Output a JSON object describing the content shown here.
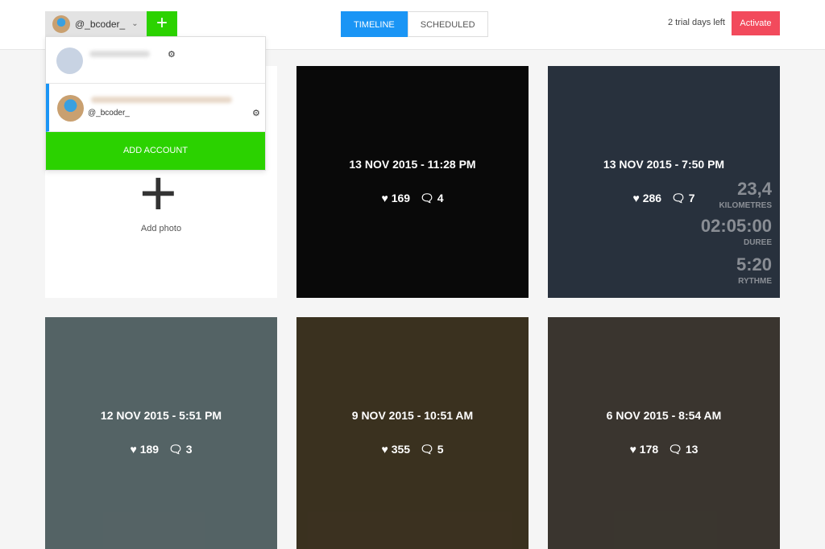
{
  "header": {
    "account": "@_bcoder_",
    "add_icon": "plus-icon",
    "tabs": [
      {
        "label": "TIMELINE",
        "active": true
      },
      {
        "label": "SCHEDULED",
        "active": false
      }
    ],
    "trial": "2 trial days left",
    "activate": "Activate"
  },
  "dropdown": {
    "accounts": [
      {
        "handle": "",
        "selected": false
      },
      {
        "handle": "@_bcoder_",
        "selected": true
      }
    ],
    "add_account": "ADD ACCOUNT"
  },
  "add_photo": {
    "label": "Add photo"
  },
  "posts": [
    {
      "date": "13 NOV 2015 - 11:28 PM",
      "likes": "169",
      "comments": "4",
      "bg": "#111"
    },
    {
      "date": "13 NOV 2015 - 7:50 PM",
      "likes": "286",
      "comments": "7",
      "bg": "#4a5a70",
      "overlay": [
        "23,4",
        "KILOMETRES",
        "02:05:00",
        "DUREE",
        "5:20",
        "RYTHME"
      ]
    },
    {
      "date": "12 NOV 2015 - 5:51 PM",
      "likes": "189",
      "comments": "3",
      "bg": "#9ab4b8"
    },
    {
      "date": "9 NOV 2015 - 10:51 AM",
      "likes": "355",
      "comments": "5",
      "bg": "#6b5a3a"
    },
    {
      "date": "6 NOV 2015 - 8:54 AM",
      "likes": "178",
      "comments": "13",
      "bg": "#6a6256"
    }
  ],
  "colors": {
    "accent": "#1a95f5",
    "green": "#2bd200",
    "activate": "#f24a5c"
  }
}
